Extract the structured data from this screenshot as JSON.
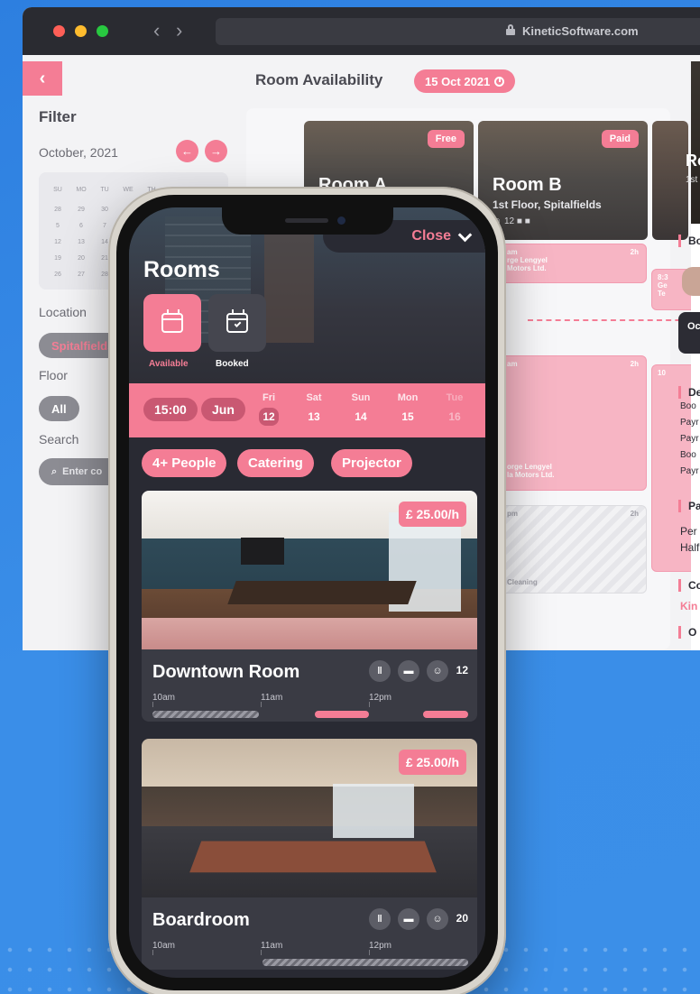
{
  "browser": {
    "url": "KineticSoftware.com",
    "page_title": "Room Availability",
    "date": "15 Oct 2021"
  },
  "filter": {
    "title": "Filter",
    "month": "October, 2021",
    "weekdays": [
      "SU",
      "MO",
      "TU",
      "WE",
      "TH",
      "FR",
      "SA"
    ],
    "weeks": [
      [
        "28",
        "29",
        "30",
        "",
        "",
        "",
        ""
      ],
      [
        "5",
        "6",
        "7",
        "",
        "",
        "",
        ""
      ],
      [
        "12",
        "13",
        "14",
        "",
        "",
        "",
        ""
      ],
      [
        "19",
        "20",
        "21",
        "",
        "",
        "",
        ""
      ],
      [
        "26",
        "27",
        "28",
        "",
        "",
        "",
        ""
      ]
    ],
    "location_label": "Location",
    "location_value": "Spitalfields",
    "floor_label": "Floor",
    "floor_value": "All",
    "search_label": "Search",
    "search_placeholder": "Enter co"
  },
  "desktop_rooms": [
    {
      "name": "Room A",
      "badge": "Free"
    },
    {
      "name": "Room B",
      "badge": "Paid",
      "sub": "1st Floor, Spitalfields",
      "capacity": "12"
    }
  ],
  "desktop_slots": {
    "a1_time": "am",
    "a1_dur": "2h",
    "a1_line1": "rge Lengyel",
    "a1_line2": "Motors Ltd.",
    "b1_time": "8:3",
    "b1_line1": "Ge",
    "b1_line2": "Te",
    "a2_time": "am",
    "a2_dur": "2h",
    "a2_line1": "orge Lengyel",
    "a2_line2": "la Motors Ltd.",
    "b2_time": "10",
    "a3_time": "pm",
    "a3_dur": "2h",
    "a3_line1": "Cleaning"
  },
  "detail_panel": {
    "title": "Ro",
    "sub": "1st",
    "h_booking": "Bo",
    "dark_label": "Oc",
    "h_details": "De",
    "details": [
      "Boo",
      "Payr",
      "Payr",
      "Boo",
      "Payr"
    ],
    "h_pricing": "Pa",
    "pricing": [
      "Per",
      "Half"
    ],
    "h_company": "Co",
    "company": "Kin",
    "h_other": "O"
  },
  "mobile": {
    "close_label": "Close",
    "title": "Rooms",
    "tabs": [
      {
        "label": "Available"
      },
      {
        "label": "Booked"
      }
    ],
    "time": "15:00",
    "month": "Jun",
    "days": [
      {
        "name": "Fri",
        "num": "12"
      },
      {
        "name": "Sat",
        "num": "13"
      },
      {
        "name": "Sun",
        "num": "14"
      },
      {
        "name": "Mon",
        "num": "15"
      },
      {
        "name": "Tue",
        "num": "16"
      }
    ],
    "filters": [
      "4+ People",
      "Catering",
      "Projector"
    ],
    "rooms": [
      {
        "name": "Downtown Room",
        "price": "£ 25.00/h",
        "capacity": "12",
        "times": [
          "10am",
          "11am",
          "12pm"
        ]
      },
      {
        "name": "Boardroom",
        "price": "£ 25.00/h",
        "capacity": "20",
        "times": [
          "10am",
          "11am",
          "12pm"
        ]
      }
    ]
  },
  "colors": {
    "accent": "#f47d95",
    "dark": "#292a33",
    "background": "#3a8ee8"
  }
}
